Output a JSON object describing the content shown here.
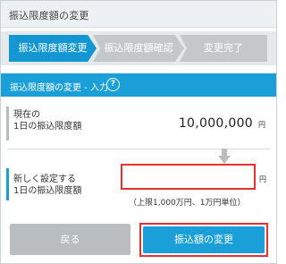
{
  "page": {
    "title": "振込限度額の変更"
  },
  "steps": [
    {
      "label": "振込限度額変更",
      "state": "active"
    },
    {
      "label": "振込限度額確認",
      "state": "inactive"
    },
    {
      "label": "変更完了",
      "state": "inactive"
    }
  ],
  "section": {
    "title": "振込限度額の変更 - 入力",
    "help_icon": "question-circle-icon",
    "help_glyph": "?"
  },
  "current_limit": {
    "label_line1": "現在の",
    "label_line2": "1日の振込限度額",
    "value": "10,000,000",
    "unit": "円"
  },
  "new_limit": {
    "label_line1": "新しく設定する",
    "label_line2": "1日の振込限度額",
    "value": "",
    "unit": "円",
    "note": "（上限1,000万円、1万円単位）"
  },
  "buttons": {
    "back": "戻る",
    "submit": "振込額の変更"
  },
  "colors": {
    "accent": "#1a9fd8",
    "step_active": "#1396d2",
    "step_inactive": "#c4c8cb",
    "highlight": "#e53131",
    "back_button": "#b9bdc0"
  }
}
